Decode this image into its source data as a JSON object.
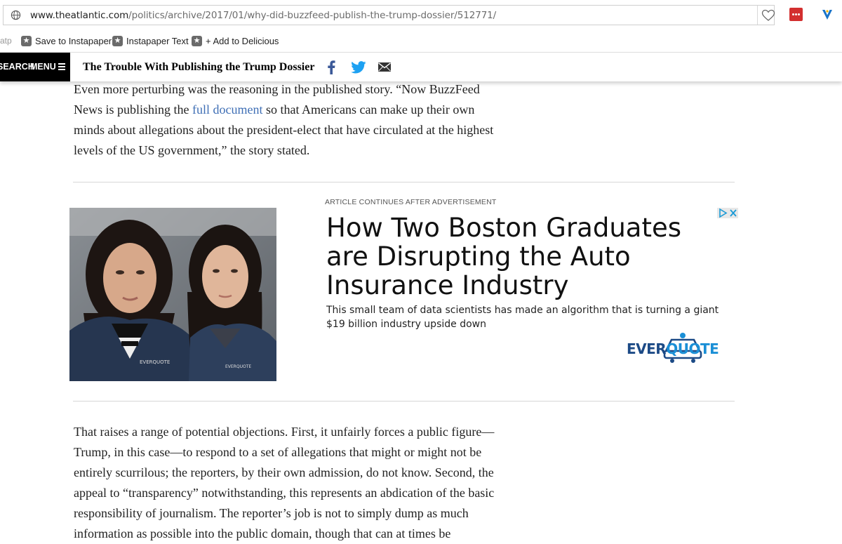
{
  "browser": {
    "url_host": "www.theatlantic.com",
    "url_path": "/politics/archive/2017/01/why-did-buzzfeed-publish-the-trump-dossier/512771/"
  },
  "bookmarks": {
    "cut_label": "atp",
    "items": [
      {
        "label": "Save to Instapaper",
        "icon": "bookmark-star-icon"
      },
      {
        "label": "Instapaper Text",
        "icon": "bookmark-star-icon"
      },
      {
        "label": "+ Add to Delicious",
        "icon": "bookmark-star-icon"
      }
    ]
  },
  "site_header": {
    "search_label": "SEARCH",
    "menu_label": "MENU",
    "article_title": "The Trouble With Publishing the Trump Dossier",
    "share_icons": [
      "facebook-icon",
      "twitter-icon",
      "email-icon"
    ]
  },
  "article": {
    "para1": {
      "before_link": "Even more perturbing was the reasoning in the published story. “Now BuzzFeed News is publishing the ",
      "link": "full document",
      "after_link": " so that Americans can make up their own minds about allegations about the president-elect that have circulated at the highest levels of the US government,” the story stated."
    },
    "para2": "That raises a range of potential objections. First, it unfairly forces a public figure—Trump, in this case—to respond to a set of allegations that might or might not be entirely scurrilous; the reporters, by their own admission, do not know. Second, the appeal to “transparency” notwithstanding, this represents an abdication of the basic responsibility of journalism. The reporter’s job is not to simply dump as much information as possible into the public domain, though that can at times be"
  },
  "ad": {
    "label": "ARTICLE CONTINUES AFTER ADVERTISEMENT",
    "headline_lines": [
      "How Two Boston Graduates",
      "are Disrupting the Auto",
      "Insurance Industry"
    ],
    "description": "This small team of data scientists has made an algorithm that is turning a giant $19 billion industry upside down",
    "logo_a": "EVER",
    "logo_b": "QUOTE",
    "hoodie_text": "EVERQUOTE"
  },
  "colors": {
    "link": "#3f6fb5",
    "facebook": "#3b5998",
    "twitter": "#1da1f2",
    "pocket": "#d32f2f",
    "logo_dark": "#1c4a86",
    "logo_light": "#1a8fd6"
  }
}
